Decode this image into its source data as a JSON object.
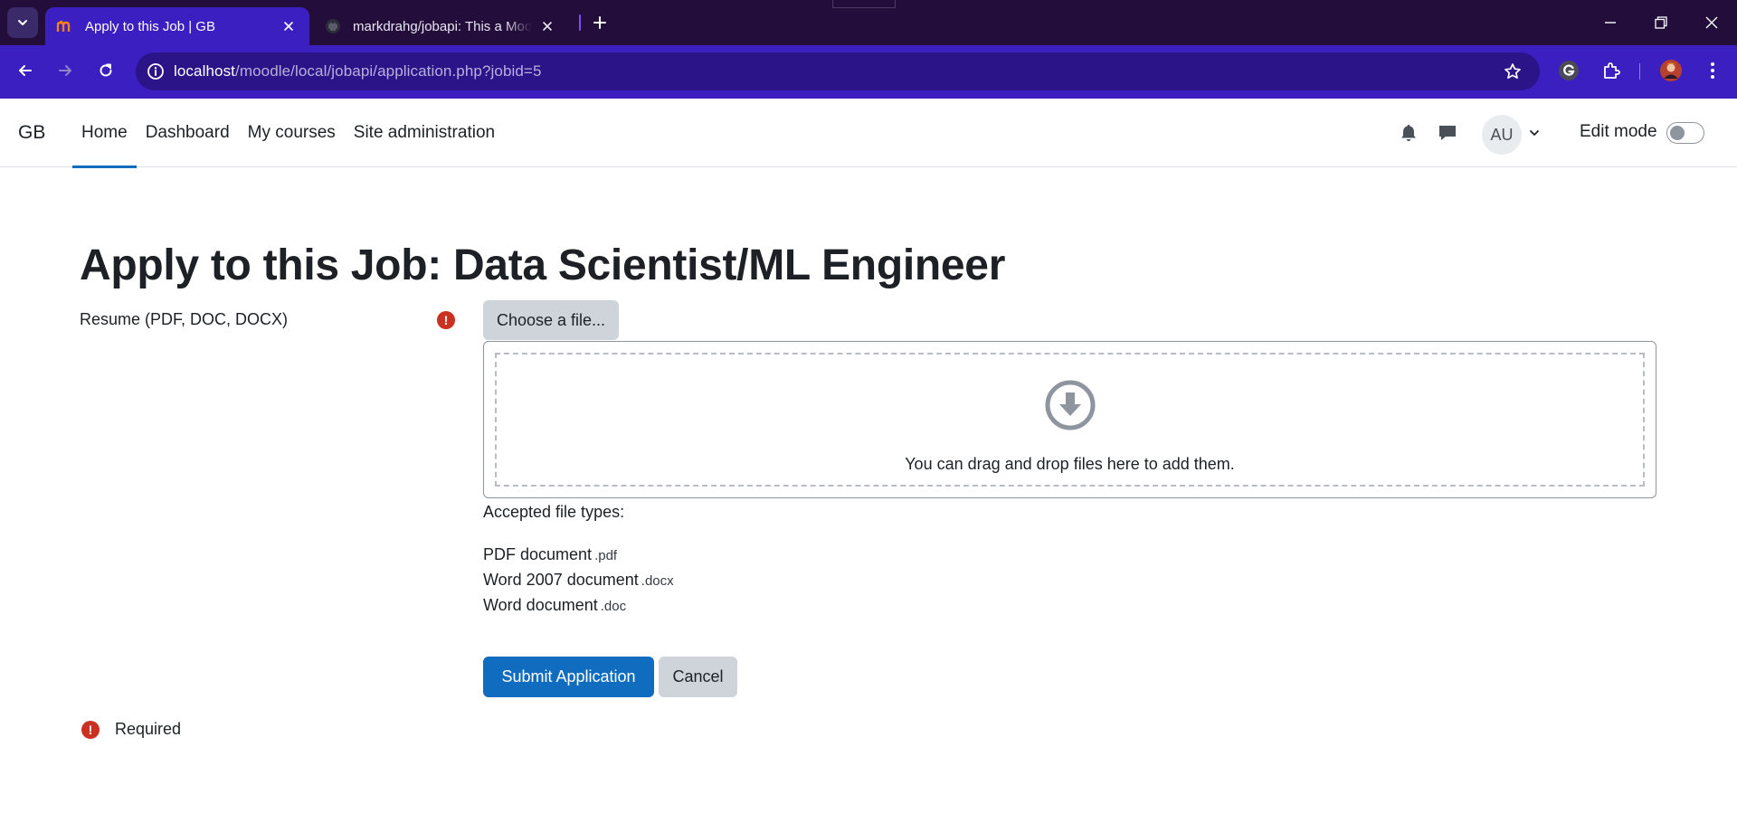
{
  "browser": {
    "tabs": [
      {
        "title": "Apply to this Job | GB",
        "active": true
      },
      {
        "title": "markdrahg/jobapi: This a Moodle",
        "active": false
      }
    ],
    "url_host": "localhost",
    "url_path": "/moodle/local/jobapi/application.php?jobid=5",
    "theme_color": "#3b1fc0",
    "tabstrip_color": "#230d3a"
  },
  "navbar": {
    "brand": "GB",
    "items": [
      {
        "label": "Home",
        "active": true
      },
      {
        "label": "Dashboard",
        "active": false
      },
      {
        "label": "My courses",
        "active": false
      },
      {
        "label": "Site administration",
        "active": false
      }
    ],
    "user_initials": "AU",
    "edit_mode_label": "Edit mode",
    "edit_mode_on": false,
    "accent_color": "#0f6cbf"
  },
  "page": {
    "title": "Apply to this Job: Data Scientist/ML Engineer",
    "resume_label": "Resume (PDF, DOC, DOCX)",
    "required_icon": "!",
    "choose_file_label": "Choose a file...",
    "dropzone_text": "You can drag and drop files here to add them.",
    "accepted_label": "Accepted file types:",
    "file_types": [
      {
        "name": "PDF document",
        "ext": ".pdf"
      },
      {
        "name": "Word 2007 document",
        "ext": ".docx"
      },
      {
        "name": "Word document",
        "ext": ".doc"
      }
    ],
    "submit_label": "Submit Application",
    "cancel_label": "Cancel",
    "required_legend": "Required",
    "required_color": "#ca3120"
  }
}
